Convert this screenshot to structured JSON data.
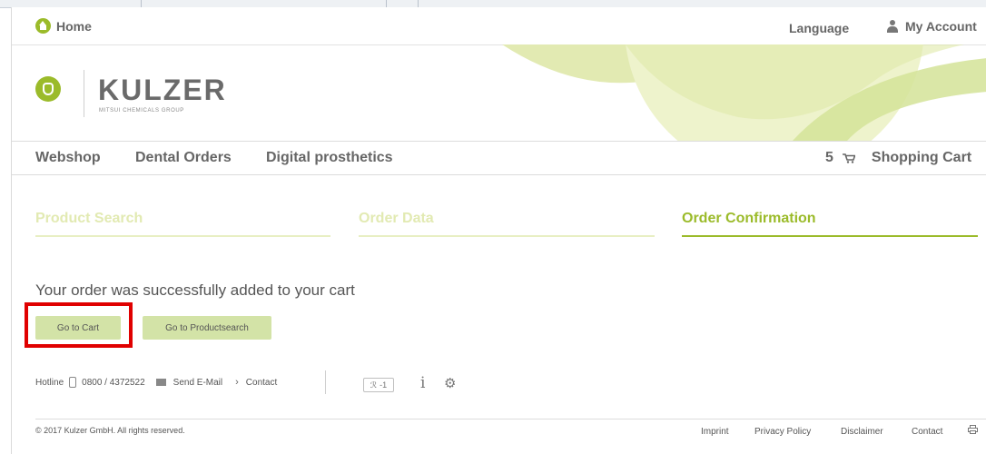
{
  "topbar": {
    "home_label": "Home",
    "language_label": "Language",
    "account_label": "My Account"
  },
  "brand": {
    "name": "KULZER",
    "tagline": "MITSUI CHEMICALS GROUP"
  },
  "nav": {
    "items": [
      "Webshop",
      "Dental Orders",
      "Digital prosthetics"
    ],
    "cart_count": "5",
    "cart_label": "Shopping Cart"
  },
  "steps": [
    {
      "label": "Product Search",
      "active": false
    },
    {
      "label": "Order Data",
      "active": false
    },
    {
      "label": "Order Confirmation",
      "active": true
    }
  ],
  "message": "Your order was successfully added to your cart",
  "buttons": {
    "cart": "Go to Cart",
    "search": "Go to Productsearch"
  },
  "footer": {
    "hotline_label": "Hotline",
    "phone": "0800 / 4372522",
    "email_label": "Send E-Mail",
    "contact_label": "Contact",
    "social_button": "-1",
    "copyright": "© 2017 Kulzer GmbH. All rights reserved.",
    "links": [
      "Imprint",
      "Privacy Policy",
      "Disclaimer",
      "Contact"
    ]
  },
  "colors": {
    "accent": "#9bbb2a",
    "step_inactive": "#e2eab2",
    "button_bg": "#d3e3a7",
    "highlight": "#e00000"
  },
  "icons": [
    "home-icon",
    "user-icon",
    "cart-icon",
    "phone-icon",
    "mail-icon",
    "chevron-right-icon",
    "info-icon",
    "gear-icon",
    "print-icon"
  ]
}
